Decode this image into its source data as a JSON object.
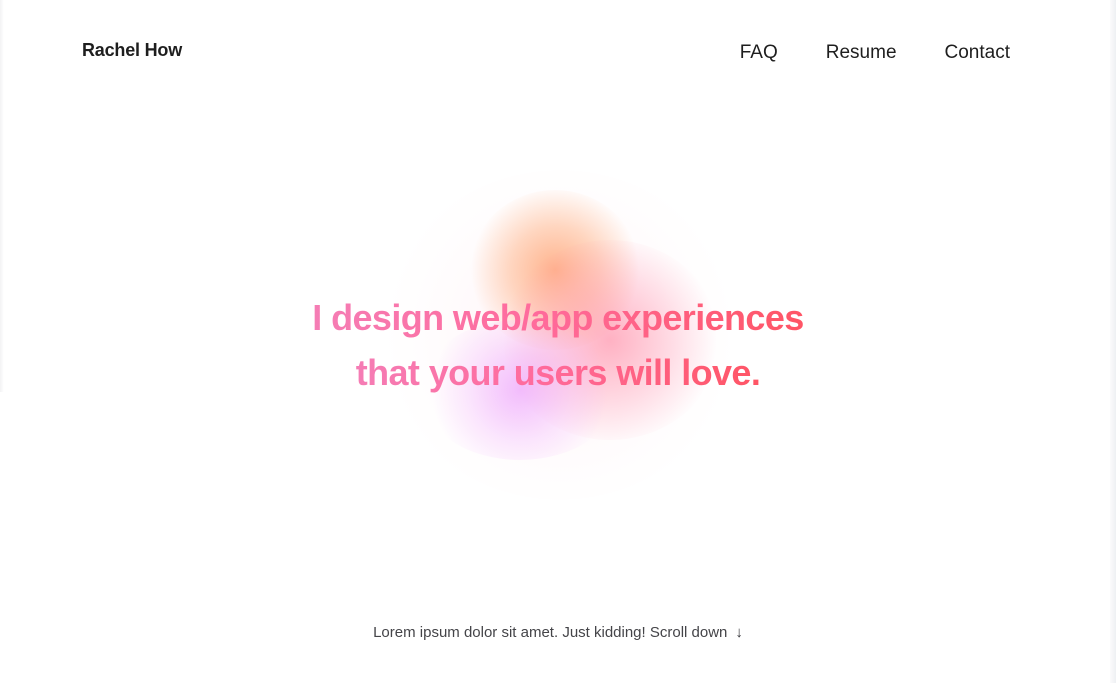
{
  "header": {
    "brand": "Rachel How",
    "nav": [
      {
        "label": "FAQ"
      },
      {
        "label": "Resume"
      },
      {
        "label": "Contact"
      }
    ]
  },
  "hero": {
    "line1": "I design web/app experiences",
    "line2": "that your users will love.",
    "gradient_colors": [
      "#f57db5",
      "#ff6b9c",
      "#ff5565"
    ],
    "blob_colors": {
      "orange": "#ffa06e",
      "pink": "#ff7896",
      "purple": "#e88cff"
    }
  },
  "footer_hint": {
    "text": "Lorem ipsum dolor sit amet. Just kidding! Scroll down",
    "icon": "arrow-down-icon",
    "glyph": "↓"
  }
}
